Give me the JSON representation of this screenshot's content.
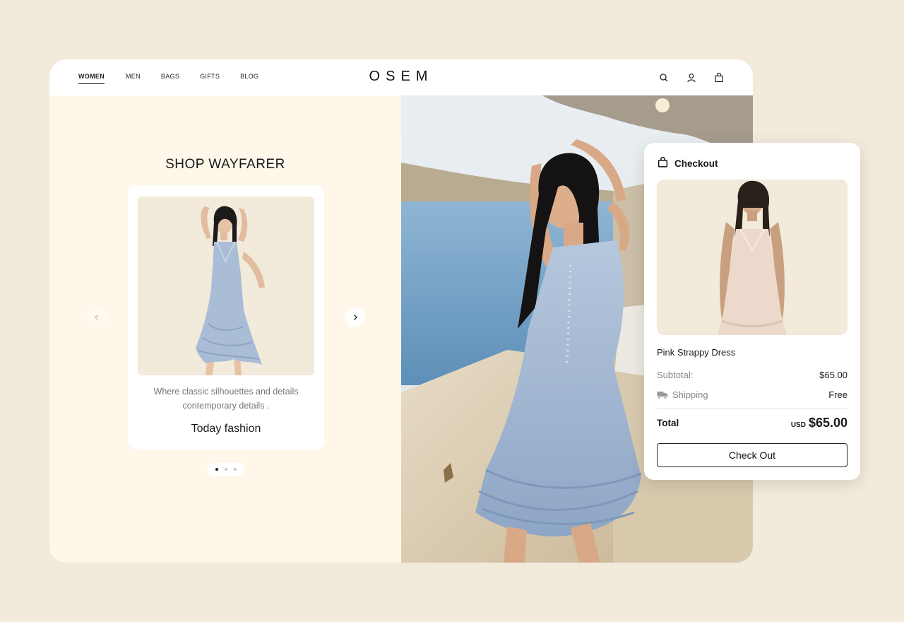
{
  "nav": {
    "links": [
      {
        "label": "WOMEN",
        "active": true
      },
      {
        "label": "MEN",
        "active": false
      },
      {
        "label": "BAGS",
        "active": false
      },
      {
        "label": "GIFTS",
        "active": false
      },
      {
        "label": "BLOG",
        "active": false
      }
    ],
    "logo": "OSEM",
    "icons": [
      "search-icon",
      "user-icon",
      "bag-icon"
    ]
  },
  "promo": {
    "title": "SHOP WAYFARER",
    "description": "Where classic silhouettes and details contemporary details .",
    "subtitle": "Today fashion",
    "carousel": {
      "slides": 3,
      "active": 0
    }
  },
  "checkout": {
    "title": "Checkout",
    "product_name": "Pink Strappy Dress",
    "subtotal_label": "Subtotal:",
    "subtotal_value": "$65.00",
    "shipping_label": "Shipping",
    "shipping_value": "Free",
    "total_label": "Total",
    "total_currency": "USD",
    "total_value": "$65.00",
    "button_label": "Check Out"
  },
  "colors": {
    "page_bg": "#f2eadb",
    "panel_bg": "#fff7ea",
    "sea": "#7ea7c9",
    "dress_blue": "#a9bdd6",
    "dress_pink": "#ecd9cc"
  }
}
